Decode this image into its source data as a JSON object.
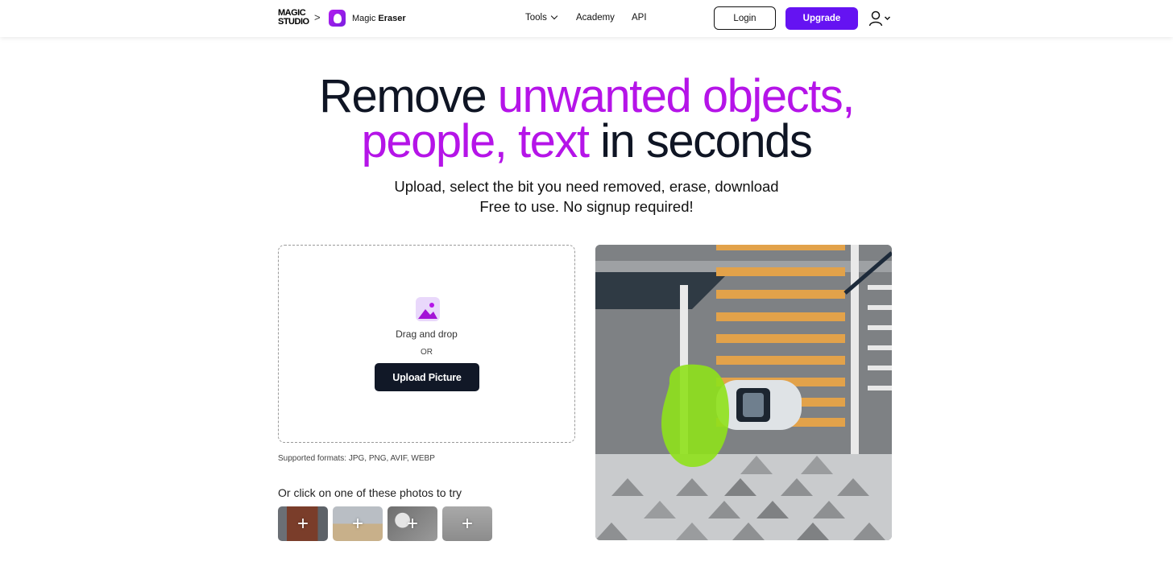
{
  "header": {
    "logo_line1": "MAGIC",
    "logo_line2": "STUDIO",
    "breadcrumb_separator": ">",
    "app_name_prefix": "Magic",
    "app_name_bold": "Eraser",
    "nav": {
      "tools": "Tools",
      "academy": "Academy",
      "api": "API"
    },
    "login": "Login",
    "upgrade": "Upgrade",
    "brand_color": "#6513f2"
  },
  "hero": {
    "line1_plain": "Remove ",
    "line1_accent": "unwanted objects,",
    "line2_accent": "people, text",
    "line2_plain": " in seconds",
    "subtitle_line1": "Upload, select the bit you need removed, erase, download",
    "subtitle_line2": "Free to use. No signup required!",
    "accent_color": "#b514e8"
  },
  "upload": {
    "drag_text": "Drag and drop",
    "or_text": "OR",
    "button_label": "Upload Picture",
    "formats_text": "Supported formats: JPG, PNG, AVIF, WEBP"
  },
  "samples": {
    "label": "Or click on one of these photos to try",
    "items": [
      {
        "icon": "plus-icon",
        "plus": "+"
      },
      {
        "icon": "plus-icon",
        "plus": "+"
      },
      {
        "icon": "plus-icon",
        "plus": "+"
      },
      {
        "icon": "plus-icon",
        "plus": "+"
      }
    ]
  },
  "preview": {
    "highlight_color": "#9be41e"
  }
}
